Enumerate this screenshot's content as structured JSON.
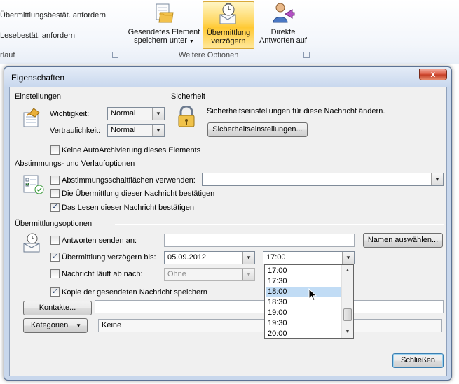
{
  "ribbon": {
    "left_items": [
      "Übermittlungsbestät. anfordern",
      "Lesebestät. anfordern"
    ],
    "left_group_fragment": "rlauf",
    "buttons": [
      {
        "label_line1": "Gesendetes Element",
        "label_line2": "speichern unter",
        "has_dropdown": true,
        "icon": "save-folder-icon"
      },
      {
        "label_line1": "Übermittlung",
        "label_line2": "verzögern",
        "active": true,
        "icon": "delay-delivery-icon"
      },
      {
        "label_line1": "Direkte",
        "label_line2": "Antworten auf",
        "icon": "direct-replies-icon"
      }
    ],
    "group_label": "Weitere Optionen"
  },
  "dialog": {
    "title": "Eigenschaften",
    "close_label": "x",
    "settings": {
      "group_label": "Einstellungen",
      "importance_label": "Wichtigkeit:",
      "importance_value": "Normal",
      "sensitivity_label": "Vertraulichkeit:",
      "sensitivity_value": "Normal",
      "no_autoarchive_label": "Keine AutoArchivierung dieses Elements",
      "no_autoarchive_checked": false
    },
    "security": {
      "group_label": "Sicherheit",
      "description": "Sicherheitseinstellungen für diese Nachricht ändern.",
      "button_label": "Sicherheitseinstellungen..."
    },
    "voting": {
      "group_label": "Abstimmungs- und Verlaufoptionen",
      "voting_buttons_label": "Abstimmungsschaltflächen verwenden:",
      "voting_buttons_checked": false,
      "voting_value": "",
      "delivery_receipt_label": "Die Übermittlung dieser Nachricht bestätigen",
      "delivery_receipt_checked": false,
      "read_receipt_label": "Das Lesen dieser Nachricht bestätigen",
      "read_receipt_checked": true
    },
    "delivery": {
      "group_label": "Übermittlungsoptionen",
      "reply_to_label": "Antworten senden an:",
      "reply_to_checked": false,
      "reply_to_value": "",
      "select_names_label": "Namen auswählen...",
      "delay_label": "Übermittlung verzögern bis:",
      "delay_checked": true,
      "delay_date": "05.09.2012",
      "delay_time": "17:00",
      "expires_label": "Nachricht läuft ab nach:",
      "expires_checked": false,
      "expires_date": "Ohne",
      "save_copy_label": "Kopie der gesendeten Nachricht speichern",
      "save_copy_checked": true
    },
    "contacts_button": "Kontakte...",
    "contacts_value": "",
    "categories_button": "Kategorien",
    "categories_value": "Keine",
    "close_button": "Schließen",
    "time_options": [
      "17:00",
      "17:30",
      "18:00",
      "18:30",
      "19:00",
      "19:30",
      "20:00"
    ],
    "time_selected": "18:00"
  }
}
